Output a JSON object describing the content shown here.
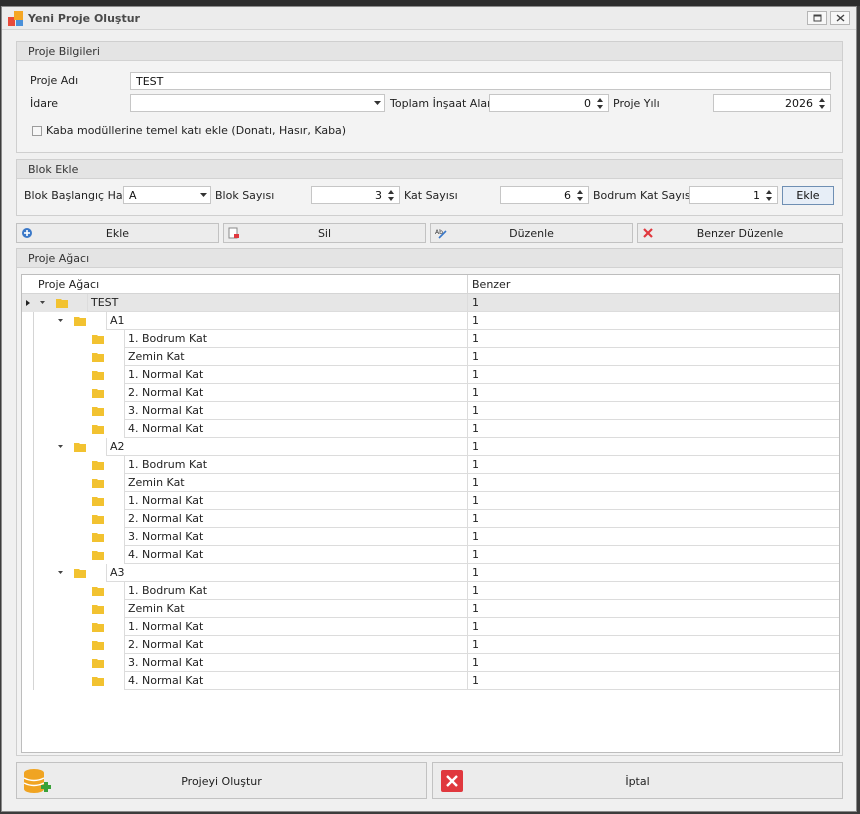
{
  "window": {
    "title": "Yeni Proje Oluştur"
  },
  "proje_bilgileri": {
    "header": "Proje Bilgileri",
    "proje_adi_label": "Proje Adı",
    "proje_adi_value": "TEST",
    "idare_label": "İdare",
    "idare_value": "",
    "toplam_alan_label": "Toplam İnşaat Alanı",
    "toplam_alan_value": "0",
    "proje_yili_label": "Proje Yılı",
    "proje_yili_value": "2026",
    "checkbox_label": "Kaba modüllerine temel katı ekle (Donatı, Hasır, Kaba)"
  },
  "blok_ekle": {
    "header": "Blok Ekle",
    "baslangic_label": "Blok Başlangıç Harfi",
    "baslangic_value": "A",
    "blok_sayisi_label": "Blok Sayısı",
    "blok_sayisi_value": "3",
    "kat_sayisi_label": "Kat Sayısı",
    "kat_sayisi_value": "6",
    "bodrum_label": "Bodrum Kat Sayısı",
    "bodrum_value": "1",
    "ekle_button": "Ekle"
  },
  "toolbar": {
    "ekle": "Ekle",
    "sil": "Sil",
    "duzenle": "Düzenle",
    "benzer_duzenle": "Benzer Düzenle"
  },
  "tree": {
    "header": "Proje Ağacı",
    "col1": "Proje Ağacı",
    "col2": "Benzer",
    "rows": [
      {
        "level": 0,
        "label": "TEST",
        "benzer": "1",
        "expandable": true
      },
      {
        "level": 1,
        "label": "A1",
        "benzer": "1",
        "expandable": true
      },
      {
        "level": 2,
        "label": "1. Bodrum Kat",
        "benzer": "1"
      },
      {
        "level": 2,
        "label": "Zemin Kat",
        "benzer": "1"
      },
      {
        "level": 2,
        "label": "1. Normal Kat",
        "benzer": "1"
      },
      {
        "level": 2,
        "label": "2. Normal Kat",
        "benzer": "1"
      },
      {
        "level": 2,
        "label": "3. Normal Kat",
        "benzer": "1"
      },
      {
        "level": 2,
        "label": "4. Normal Kat",
        "benzer": "1"
      },
      {
        "level": 1,
        "label": "A2",
        "benzer": "1",
        "expandable": true
      },
      {
        "level": 2,
        "label": "1. Bodrum Kat",
        "benzer": "1"
      },
      {
        "level": 2,
        "label": "Zemin Kat",
        "benzer": "1"
      },
      {
        "level": 2,
        "label": "1. Normal Kat",
        "benzer": "1"
      },
      {
        "level": 2,
        "label": "2. Normal Kat",
        "benzer": "1"
      },
      {
        "level": 2,
        "label": "3. Normal Kat",
        "benzer": "1"
      },
      {
        "level": 2,
        "label": "4. Normal Kat",
        "benzer": "1"
      },
      {
        "level": 1,
        "label": "A3",
        "benzer": "1",
        "expandable": true
      },
      {
        "level": 2,
        "label": "1. Bodrum Kat",
        "benzer": "1"
      },
      {
        "level": 2,
        "label": "Zemin Kat",
        "benzer": "1"
      },
      {
        "level": 2,
        "label": "1. Normal Kat",
        "benzer": "1"
      },
      {
        "level": 2,
        "label": "2. Normal Kat",
        "benzer": "1"
      },
      {
        "level": 2,
        "label": "3. Normal Kat",
        "benzer": "1"
      },
      {
        "level": 2,
        "label": "4. Normal Kat",
        "benzer": "1"
      }
    ]
  },
  "footer": {
    "olustur": "Projeyi Oluştur",
    "iptal": "İptal"
  },
  "colors": {
    "folder": "#f2c230",
    "iptal_icon": "#e0383e",
    "db_icon": "#f0a422",
    "plus_icon": "#3aa23a",
    "ekle_icon": "#3a78c8"
  }
}
